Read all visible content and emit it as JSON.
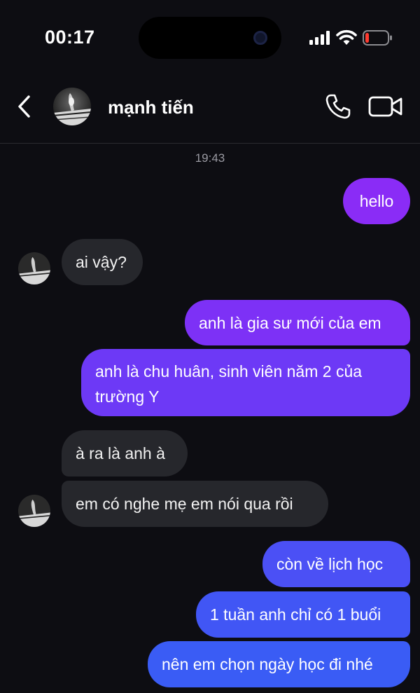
{
  "status_bar": {
    "time": "00:17"
  },
  "header": {
    "contact_name": "mạnh tiến",
    "back_icon": "chevron-left-icon",
    "call_icon": "phone-icon",
    "video_icon": "video-camera-icon"
  },
  "timestamp": "19:43",
  "colors": {
    "background": "#0d0d12",
    "incoming_bubble": "#26272c",
    "outgoing_top": "#8a2cf6",
    "outgoing_bottom": "#3e5ff5",
    "timestamp_text": "#9a9aa2"
  },
  "messages": [
    {
      "sender": "me",
      "text": "hello"
    },
    {
      "sender": "them",
      "text": "ai vậy?"
    },
    {
      "sender": "me",
      "text": "anh là gia sư mới của em"
    },
    {
      "sender": "me",
      "text": "anh là chu huân, sinh viên năm 2 của trường Y"
    },
    {
      "sender": "them",
      "text": "à ra là anh à"
    },
    {
      "sender": "them",
      "text": "em có nghe mẹ em nói qua rồi"
    },
    {
      "sender": "me",
      "text": "còn về lịch học"
    },
    {
      "sender": "me",
      "text": "1 tuần anh chỉ có 1 buổi"
    },
    {
      "sender": "me",
      "text": "nên em chọn ngày học đi nhé"
    }
  ]
}
